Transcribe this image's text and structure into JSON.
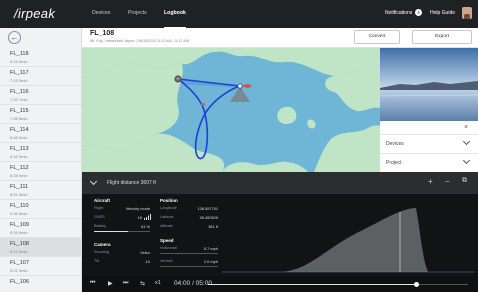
{
  "topbar": {
    "logo": "/irpeak",
    "nav": [
      "Devices",
      "Projects",
      "Logbook"
    ],
    "active_nav": 2,
    "notifications_label": "Notifications",
    "notifications_count": "4",
    "help_label": "Help Guide"
  },
  "sidebar": {
    "items": [
      {
        "title": "FL_118",
        "sub": "6:15  5min"
      },
      {
        "title": "FL_117",
        "sub": "7:15  5min"
      },
      {
        "title": "FL_116",
        "sub": "7:32  7min"
      },
      {
        "title": "FL_115",
        "sub": "7:08  8min"
      },
      {
        "title": "FL_114",
        "sub": "6:48  5min"
      },
      {
        "title": "FL_113",
        "sub": "6:32  5min"
      },
      {
        "title": "FL_112",
        "sub": "6:28  5min"
      },
      {
        "title": "FL_111",
        "sub": "5:51  8min"
      },
      {
        "title": "FL_110",
        "sub": "5:36  8min"
      },
      {
        "title": "FL_109",
        "sub": "5:26  8min"
      },
      {
        "title": "FL_108",
        "sub": "5:12  5min"
      },
      {
        "title": "FL_107",
        "sub": "5:01  5min"
      },
      {
        "title": "FL_106",
        "sub": ""
      }
    ],
    "selected_index": 10
  },
  "header": {
    "title": "FL_108",
    "meta": "Mt. Fuji, Yamanashi Japan  |  08/30/2021 5:12 AM - 5:17 AM",
    "convert_label": "Convert",
    "export_label": "Export"
  },
  "right_panel": {
    "close_glyph": "×",
    "rows": [
      "Devices",
      "Project"
    ]
  },
  "telemetry": {
    "title": "Flight distance  3607 ft",
    "tools": [
      "+",
      "−",
      "⧉"
    ],
    "aircraft": {
      "title": "Aircraft",
      "rows": [
        {
          "k": "Flight",
          "v": "Velocity mode"
        },
        {
          "k": "GNSS",
          "v": "18"
        },
        {
          "k": "Battery",
          "v": "61 %"
        }
      ],
      "battery_level": 0.61
    },
    "camera": {
      "title": "Camera",
      "rows": [
        {
          "k": "Shooting",
          "v": "Video"
        },
        {
          "k": "Tilt",
          "v": "-10"
        }
      ]
    },
    "position": {
      "title": "Position",
      "rows": [
        {
          "k": "Longitude",
          "v": "138.597751"
        },
        {
          "k": "Latitude",
          "v": "35.490529"
        },
        {
          "k": "Altitude",
          "v": "361 ft"
        }
      ]
    },
    "speed": {
      "title": "Speed",
      "rows": [
        {
          "k": "Horizontal",
          "v": "5.7 mph"
        },
        {
          "k": "Vertical",
          "v": "2.0 mph"
        }
      ]
    }
  },
  "player": {
    "time": "04:00 / 05:00",
    "speed": "x1",
    "progress": 0.8
  }
}
